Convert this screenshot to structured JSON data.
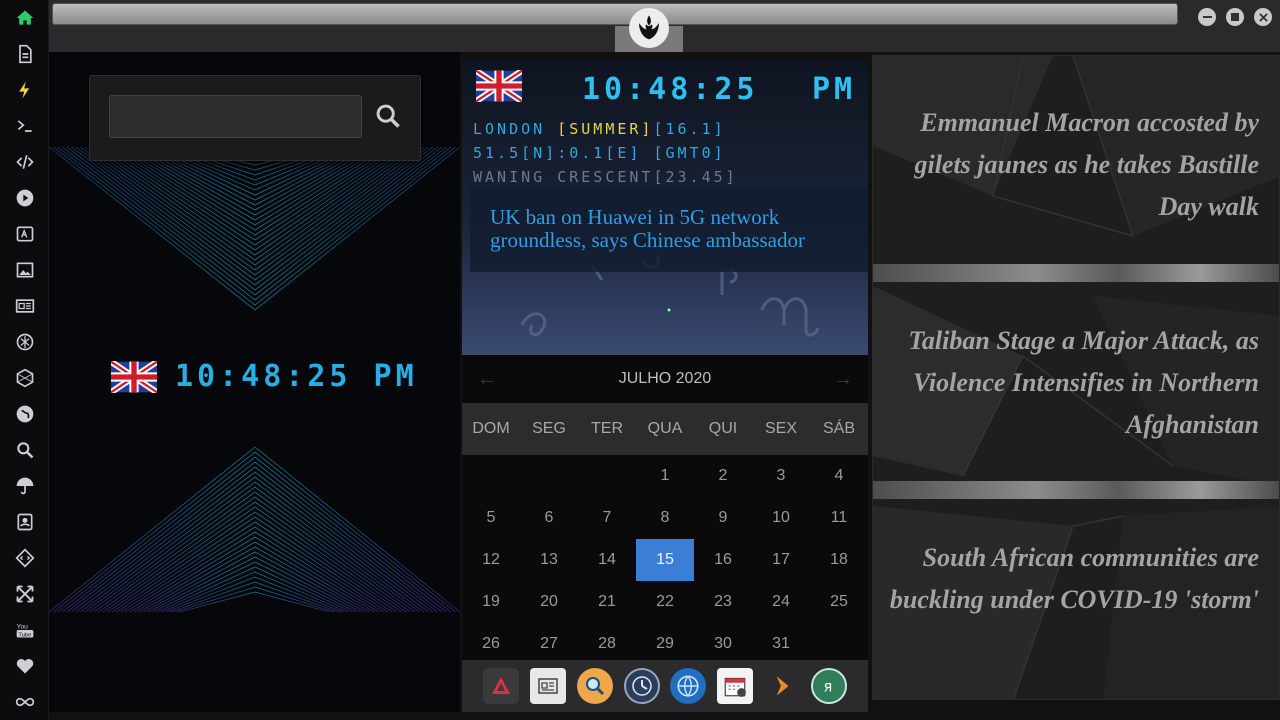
{
  "sidebar": {
    "icons": [
      "home-icon",
      "document-icon",
      "lightning-icon",
      "terminal-icon",
      "code-icon",
      "play-icon",
      "translate-icon",
      "image-icon",
      "news-icon",
      "rebel-icon",
      "hexagon-icon",
      "globe-icon",
      "search-icon",
      "umbrella-icon",
      "contacts-icon",
      "diamond-code-icon",
      "expand-icon",
      "youtube-icon",
      "heart-icon",
      "infinity-icon"
    ],
    "active_color": "#2ecc71"
  },
  "search": {
    "value": "",
    "placeholder": ""
  },
  "left_clock": {
    "time": "10:48:25 PM"
  },
  "world_clock": {
    "time": "10:48:25",
    "ampm": "PM",
    "location": "LONDON",
    "season": "[SUMMER]",
    "temp": "[16.1]",
    "coords": "51.5[N]:0.1[E] [GMT0]",
    "moon": "WANING CRESCENT[23.45]"
  },
  "news_card": {
    "text": "UK ban on Huawei in 5G network groundless, says Chinese ambassador"
  },
  "calendar": {
    "month_label": "JULHO 2020",
    "weekdays": [
      "DOM",
      "SEG",
      "TER",
      "QUA",
      "QUI",
      "SEX",
      "SÁB"
    ],
    "days": [
      "",
      "",
      "",
      "1",
      "2",
      "3",
      "4",
      "5",
      "6",
      "7",
      "8",
      "9",
      "10",
      "11",
      "12",
      "13",
      "14",
      "15",
      "16",
      "17",
      "18",
      "19",
      "20",
      "21",
      "22",
      "23",
      "24",
      "25",
      "26",
      "27",
      "28",
      "29",
      "30",
      "31",
      ""
    ],
    "today": "15"
  },
  "dock": {
    "icons": [
      "appstore-icon",
      "newspaper-icon",
      "search-app-icon",
      "clock-app-icon",
      "browser-icon",
      "calendar-app-icon",
      "play-arrow-icon",
      "yandex-icon"
    ]
  },
  "headlines": [
    "Emmanuel Macron accosted by gilets jaunes as he takes Bastille Day walk",
    "Taliban Stage a Major Attack, as Violence Intensifies in Northern Afghanistan",
    "South African communities are buckling under COVID-19 'storm'"
  ]
}
